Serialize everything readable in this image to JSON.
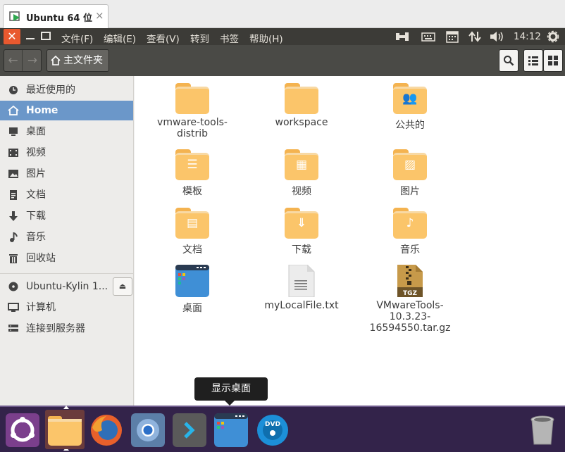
{
  "vm_tab": {
    "title": "Ubuntu 64 位",
    "close": "×"
  },
  "window": {
    "close_glyph": "✕"
  },
  "menubar": [
    "文件(F)",
    "编辑(E)",
    "查看(V)",
    "转到",
    "书签",
    "帮助(H)"
  ],
  "tray": {
    "time": "14:12"
  },
  "toolbar": {
    "back": "←",
    "forward": "→",
    "path_label": "主文件夹"
  },
  "sidebar": {
    "items": [
      {
        "label": "最近使用的",
        "icon": "clock-icon",
        "active": false
      },
      {
        "label": "Home",
        "icon": "home-icon",
        "active": true
      },
      {
        "label": "桌面",
        "icon": "desktop-icon",
        "active": false
      },
      {
        "label": "视频",
        "icon": "video-icon",
        "active": false
      },
      {
        "label": "图片",
        "icon": "picture-icon",
        "active": false
      },
      {
        "label": "文档",
        "icon": "document-icon",
        "active": false
      },
      {
        "label": "下载",
        "icon": "download-icon",
        "active": false
      },
      {
        "label": "音乐",
        "icon": "music-icon",
        "active": false
      },
      {
        "label": "回收站",
        "icon": "trash-icon",
        "active": false
      }
    ],
    "devices": [
      {
        "label": "Ubuntu-Kylin 1...",
        "icon": "disc-icon"
      },
      {
        "label": "计算机",
        "icon": "computer-icon"
      },
      {
        "label": "连接到服务器",
        "icon": "network-icon"
      }
    ],
    "eject": "⏏"
  },
  "files": [
    {
      "label": "vmware-tools-distrib",
      "kind": "folder",
      "glyph": ""
    },
    {
      "label": "workspace",
      "kind": "folder",
      "glyph": ""
    },
    {
      "label": "公共的",
      "kind": "folder",
      "glyph": "👥"
    },
    {
      "label": "模板",
      "kind": "folder",
      "glyph": "☰"
    },
    {
      "label": "视频",
      "kind": "folder",
      "glyph": "▦"
    },
    {
      "label": "图片",
      "kind": "folder",
      "glyph": "▨"
    },
    {
      "label": "文档",
      "kind": "folder",
      "glyph": "▤"
    },
    {
      "label": "下载",
      "kind": "folder",
      "glyph": "⇓"
    },
    {
      "label": "音乐",
      "kind": "folder",
      "glyph": "♪"
    },
    {
      "label": "桌面",
      "kind": "desktop"
    },
    {
      "label": "myLocalFile.txt",
      "kind": "text"
    },
    {
      "label": "VMwareTools-10.3.23-16594550.tar.gz",
      "kind": "archive",
      "badge": "TGZ"
    }
  ],
  "tooltip": {
    "text": "显示桌面"
  },
  "dock": {
    "icons": [
      "ubuntu-logo-icon",
      "files-icon",
      "firefox-icon",
      "chromium-icon",
      "terminal-icon",
      "show-desktop-icon",
      "dvd-icon",
      "trash-icon"
    ],
    "dvd_badge": "DVD"
  }
}
